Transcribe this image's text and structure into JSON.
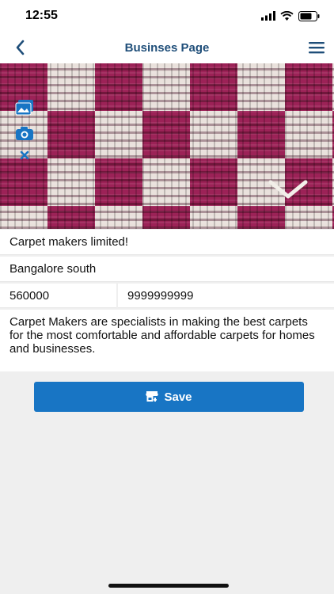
{
  "status_bar": {
    "time": "12:55"
  },
  "nav": {
    "title": "Businses Page"
  },
  "hero": {
    "icons": [
      "gallery-icon",
      "camera-icon",
      "close-icon",
      "chevron-down-icon"
    ]
  },
  "form": {
    "business_name": "Carpet makers limited!",
    "address": "Bangalore south",
    "pincode": "560000",
    "phone": "9999999999",
    "description": "Carpet Makers are specialists in making the best carpets for the most comfortable and affordable carpets for homes and businesses."
  },
  "actions": {
    "save_label": "Save"
  },
  "colors": {
    "accent": "#1875c4",
    "title": "#1f4e79"
  }
}
